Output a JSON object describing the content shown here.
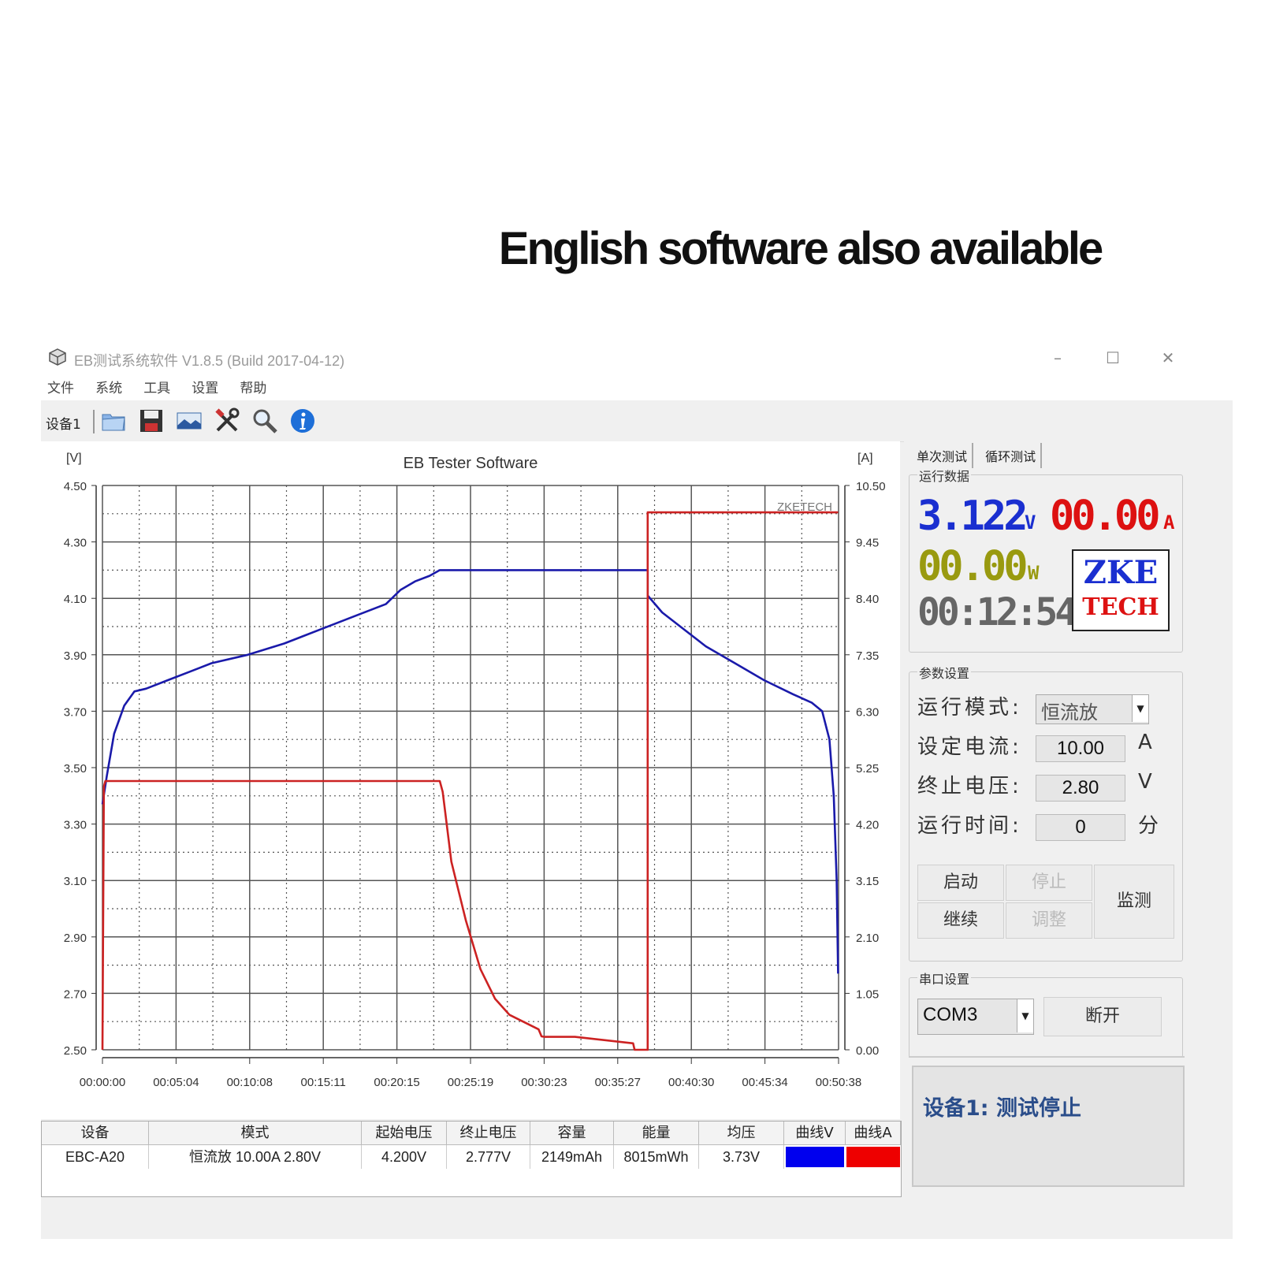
{
  "banner": "English software also available",
  "window": {
    "title": "EB测试系统软件 V1.8.5 (Build 2017-04-12)",
    "controls": {
      "minimize": "–",
      "maximize": "☐",
      "close": "✕"
    }
  },
  "menu": [
    "文件",
    "系统",
    "工具",
    "设置",
    "帮助"
  ],
  "toolbar": {
    "device_label": "设备1",
    "icons": [
      "folder-icon",
      "save-icon",
      "image-icon",
      "tools-icon",
      "zoom-icon",
      "info-icon"
    ]
  },
  "chart_data": {
    "type": "line",
    "title": "EB Tester Software",
    "watermark": "ZKETECH",
    "left_unit": "[V]",
    "right_unit": "[A]",
    "ylim_left": [
      2.5,
      4.5
    ],
    "ylim_right": [
      0.0,
      10.5
    ],
    "yticks_left": [
      "4.50",
      "4.30",
      "4.10",
      "3.90",
      "3.70",
      "3.50",
      "3.30",
      "3.10",
      "2.90",
      "2.70",
      "2.50"
    ],
    "yticks_right": [
      "10.50",
      "9.45",
      "8.40",
      "7.35",
      "6.30",
      "5.25",
      "4.20",
      "3.15",
      "2.10",
      "1.05",
      "0.00"
    ],
    "xticks": [
      "00:00:00",
      "00:05:04",
      "00:10:08",
      "00:15:11",
      "00:20:15",
      "00:25:19",
      "00:30:23",
      "00:35:27",
      "00:40:30",
      "00:45:34",
      "00:50:38"
    ],
    "x_unit_minutes_max": 50.63,
    "grid": true,
    "colors": {
      "voltage": "#1a1aaa",
      "current": "#cc2222",
      "grid": "#555555"
    },
    "series": [
      {
        "axis": "left",
        "x_minutes": [
          0,
          0.3,
          0.8,
          1.5,
          2.2,
          3.0,
          4.5,
          6.0,
          7.5,
          10,
          12.5,
          15,
          17.5,
          19.5,
          20.5,
          21.5,
          22.5,
          23.2,
          30,
          37.5,
          37.5,
          38.5,
          40,
          41.5,
          43.5,
          45.5,
          47.5,
          48.8,
          49.5,
          50.0,
          50.3,
          50.5,
          50.6
        ],
        "values": [
          3.37,
          3.47,
          3.62,
          3.72,
          3.77,
          3.78,
          3.81,
          3.84,
          3.87,
          3.9,
          3.94,
          3.99,
          4.04,
          4.08,
          4.13,
          4.16,
          4.18,
          4.2,
          4.2,
          4.2,
          4.11,
          4.05,
          3.99,
          3.93,
          3.87,
          3.81,
          3.76,
          3.73,
          3.7,
          3.6,
          3.4,
          3.1,
          2.77
        ]
      },
      {
        "axis": "right",
        "x_minutes": [
          0,
          0.1,
          0.2,
          23.2,
          23.4,
          24,
          25,
          26,
          27,
          28,
          30,
          30.2,
          30.4,
          32.5,
          36.5,
          36.6,
          37.5,
          37.5,
          40,
          45,
          50.6
        ],
        "values": [
          0.0,
          4.9,
          5.0,
          5.0,
          4.8,
          3.5,
          2.4,
          1.5,
          0.95,
          0.65,
          0.38,
          0.25,
          0.24,
          0.24,
          0.12,
          0.0,
          0.0,
          10.0,
          10.0,
          10.0,
          10.0
        ]
      }
    ]
  },
  "right": {
    "tabs": [
      "单次测试",
      "循环测试"
    ],
    "run_data": {
      "label": "运行数据",
      "voltage": "3.122",
      "voltage_unit": "V",
      "current": "00.00",
      "current_unit": "A",
      "power": "00.00",
      "power_unit": "W",
      "time": "00:12:54",
      "logo_line1": "ZKE",
      "logo_line2": "TECH"
    },
    "params": {
      "label": "参数设置",
      "mode_label": "运行模式:",
      "mode_value": "恒流放",
      "current_label": "设定电流:",
      "current_value": "10.00",
      "current_unit": "A",
      "cutoff_label": "终止电压:",
      "cutoff_value": "2.80",
      "cutoff_unit": "V",
      "runtime_label": "运行时间:",
      "runtime_value": "0",
      "runtime_unit": "分"
    },
    "buttons": {
      "start": "启动",
      "stop": "停止",
      "continue": "继续",
      "adjust": "调整",
      "monitor": "监测"
    },
    "serial": {
      "label": "串口设置",
      "port": "COM3",
      "disconnect": "断开"
    },
    "status": "设备1: 测试停止"
  },
  "table": {
    "headers": [
      "设备",
      "模式",
      "起始电压",
      "终止电压",
      "容量",
      "能量",
      "均压",
      "曲线V",
      "曲线A"
    ],
    "row": [
      "EBC-A20",
      "恒流放 10.00A 2.80V",
      "4.200V",
      "2.777V",
      "2149mAh",
      "8015mWh",
      "3.73V"
    ],
    "swatch_v": "#0000ee",
    "swatch_a": "#ee0000"
  }
}
